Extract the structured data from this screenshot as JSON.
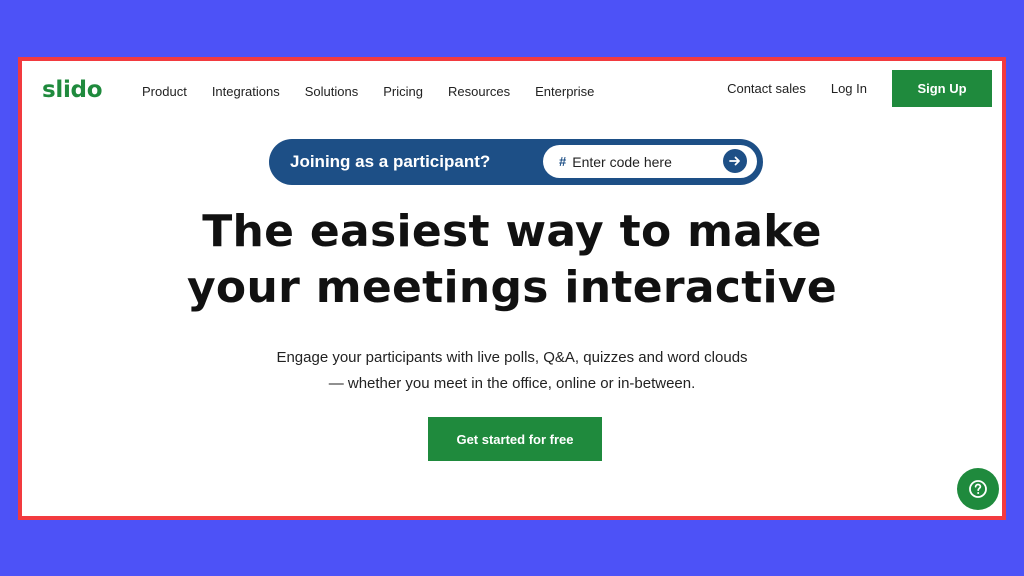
{
  "brand": {
    "logo": "slido",
    "color": "#1f8a3d"
  },
  "nav": {
    "items": [
      "Product",
      "Integrations",
      "Solutions",
      "Pricing",
      "Resources",
      "Enterprise"
    ],
    "contact_sales": "Contact sales",
    "login": "Log In",
    "signup": "Sign Up"
  },
  "join": {
    "label": "Joining as a participant?",
    "hash": "#",
    "placeholder": "Enter code here",
    "submit_icon": "arrow-right-icon",
    "bar_color": "#1d4f86"
  },
  "hero": {
    "headline_line1": "The easiest way to make",
    "headline_line2": "your meetings interactive",
    "sub_line1": "Engage your participants with live polls, Q&A, quizzes and word clouds",
    "sub_line2": "— whether you meet in the office, online or in-between.",
    "cta": "Get started for free"
  },
  "help": {
    "icon": "question-circle-icon"
  },
  "colors": {
    "background": "#4d52f7",
    "frame_border": "#f23a3f"
  }
}
